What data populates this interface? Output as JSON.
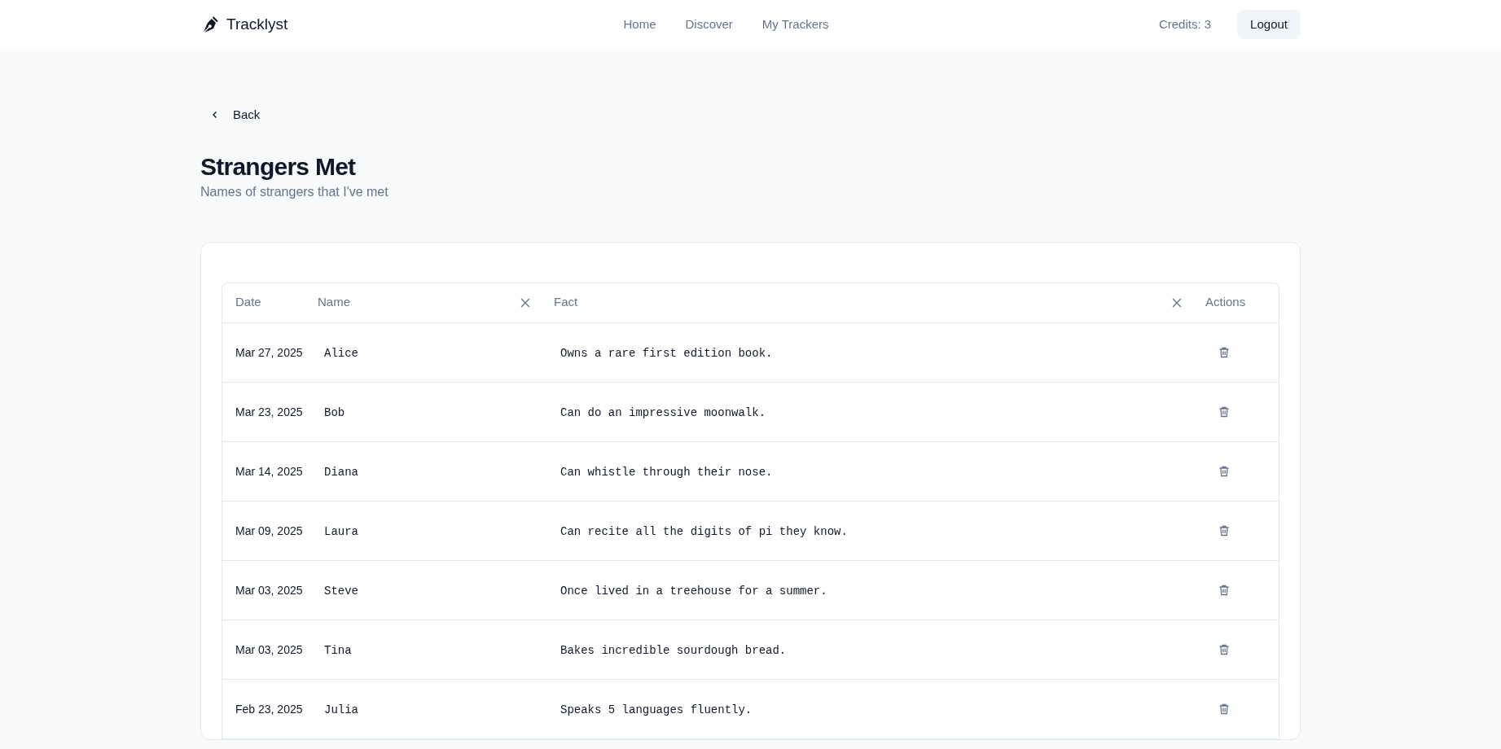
{
  "header": {
    "brand": "Tracklyst",
    "nav": [
      {
        "label": "Home"
      },
      {
        "label": "Discover"
      },
      {
        "label": "My Trackers"
      }
    ],
    "credits": "Credits: 3",
    "logout": "Logout"
  },
  "back": "Back",
  "title": "Strangers Met",
  "subtitle": "Names of strangers that I've met",
  "table": {
    "columns": [
      {
        "label": "Date",
        "clearable": false
      },
      {
        "label": "Name",
        "clearable": true
      },
      {
        "label": "Fact",
        "clearable": true
      },
      {
        "label": "Actions",
        "clearable": false
      }
    ],
    "rows": [
      {
        "date": "Mar 27, 2025",
        "name": "Alice",
        "fact": "Owns a rare first edition book."
      },
      {
        "date": "Mar 23, 2025",
        "name": "Bob",
        "fact": "Can do an impressive moonwalk."
      },
      {
        "date": "Mar 14, 2025",
        "name": "Diana",
        "fact": "Can whistle through their nose."
      },
      {
        "date": "Mar 09, 2025",
        "name": "Laura",
        "fact": "Can recite all the digits of pi they know."
      },
      {
        "date": "Mar 03, 2025",
        "name": "Steve",
        "fact": "Once lived in a treehouse for a summer."
      },
      {
        "date": "Mar 03, 2025",
        "name": "Tina",
        "fact": "Bakes incredible sourdough bread."
      },
      {
        "date": "Feb 23, 2025",
        "name": "Julia",
        "fact": "Speaks 5 languages fluently."
      }
    ]
  }
}
